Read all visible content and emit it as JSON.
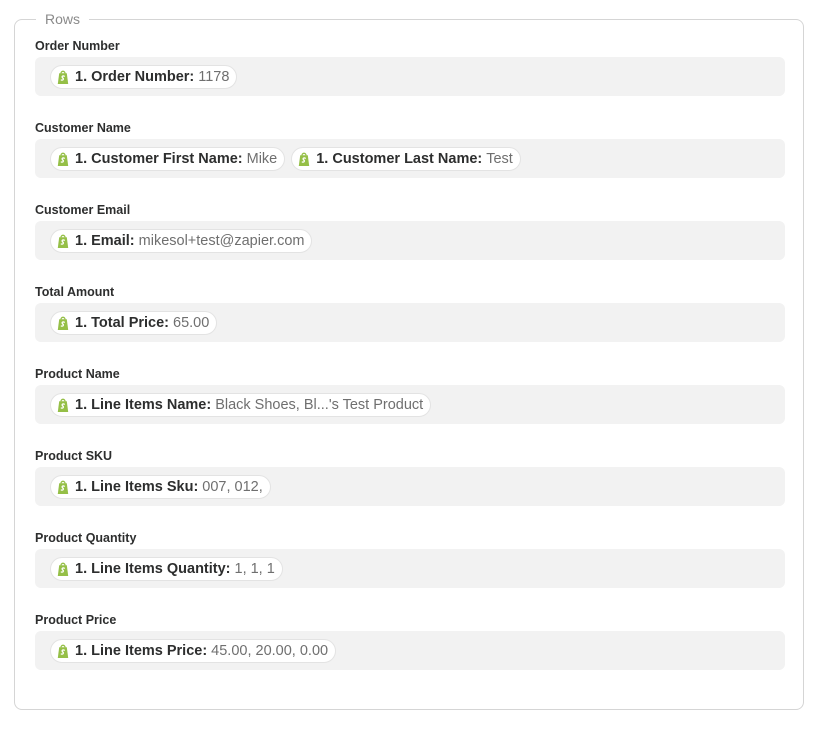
{
  "section": {
    "legend": "Rows"
  },
  "fields": [
    {
      "label": "Order Number",
      "pills": [
        {
          "key": "1. Order Number:",
          "value": "1178",
          "icon": "shopify-icon"
        }
      ]
    },
    {
      "label": "Customer Name",
      "pills": [
        {
          "key": "1. Customer First Name:",
          "value": "Mike",
          "icon": "shopify-icon"
        },
        {
          "key": "1. Customer Last Name:",
          "value": "Test",
          "icon": "shopify-icon"
        }
      ]
    },
    {
      "label": "Customer Email",
      "pills": [
        {
          "key": "1. Email:",
          "value": "mikesol+test@zapier.com",
          "icon": "shopify-icon"
        }
      ]
    },
    {
      "label": "Total Amount",
      "pills": [
        {
          "key": "1. Total Price:",
          "value": "65.00",
          "icon": "shopify-icon"
        }
      ]
    },
    {
      "label": "Product Name",
      "pills": [
        {
          "key": "1. Line Items Name:",
          "value": "Black Shoes, Bl...'s Test Product",
          "icon": "shopify-icon"
        }
      ]
    },
    {
      "label": "Product SKU",
      "pills": [
        {
          "key": "1. Line Items Sku:",
          "value": "007, 012,",
          "icon": "shopify-icon"
        }
      ]
    },
    {
      "label": "Product Quantity",
      "pills": [
        {
          "key": "1. Line Items Quantity:",
          "value": "1, 1, 1",
          "icon": "shopify-icon"
        }
      ]
    },
    {
      "label": "Product Price",
      "pills": [
        {
          "key": "1. Line Items Price:",
          "value": "45.00, 20.00, 0.00",
          "icon": "shopify-icon"
        }
      ]
    }
  ],
  "colors": {
    "shopify_green": "#95bf47",
    "shopify_dark_green": "#5e8e3e",
    "field_background": "#f2f2f2"
  }
}
